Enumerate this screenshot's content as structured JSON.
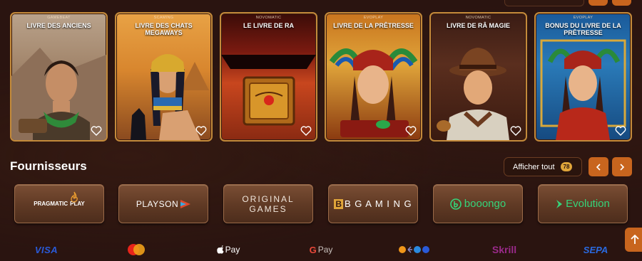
{
  "games": [
    {
      "provider": "GAMEBEAT",
      "title": "LIVRE DES ANCIENS"
    },
    {
      "provider": "SCAMING",
      "title": "LIVRE DES CHATS MEGAWAYS"
    },
    {
      "provider": "NOVOMATIC",
      "title": "LE LIVRE DE RA"
    },
    {
      "provider": "EVOPLAY",
      "title": "LIVRE DE LA PRÊTRESSE"
    },
    {
      "provider": "NOVOMATIC",
      "title": "LIVRE DE RÂ MAGIE"
    },
    {
      "provider": "EVOPLAY",
      "title": "BONUS DU LIVRE DE LA PRÊTRESSE"
    }
  ],
  "providers_section": {
    "title": "Fournisseurs",
    "show_all_label": "Afficher tout",
    "show_all_count": "78"
  },
  "providers": [
    {
      "name": "PRAGMATIC PLAY",
      "logo_text_1": "PRAGMATIC",
      "logo_text_2": "PLAY"
    },
    {
      "name": "PLAYSON",
      "logo_text": "PLAYSON"
    },
    {
      "name": "ORIGINAL GAMES",
      "logo_text_1": "ORIGINAL",
      "logo_text_2": "GAMES"
    },
    {
      "name": "BGAMING",
      "logo_text": "B G A M I N G"
    },
    {
      "name": "booongo",
      "logo_text": "booongo"
    },
    {
      "name": "Evolution",
      "logo_text": "Evolution"
    }
  ],
  "payments": {
    "visa": "VISA",
    "apple_pay": "Pay",
    "google_pay": "Pay",
    "skrill": "Skrill",
    "sepa": "SEPA"
  },
  "colors": {
    "background": "#2a1410",
    "accent": "#c8651e",
    "card_border": "#c48a3a",
    "badge": "#e0a53a"
  }
}
